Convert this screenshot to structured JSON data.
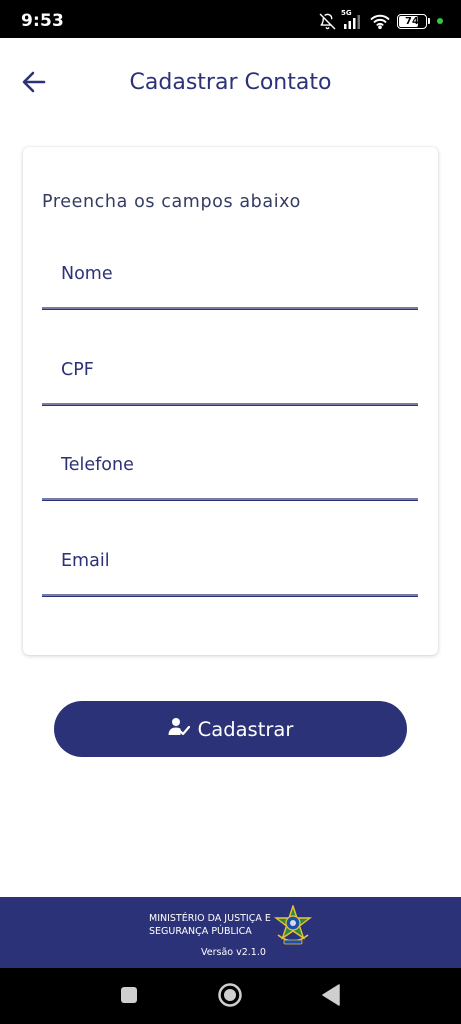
{
  "status_bar": {
    "time": "9:53",
    "network_label": "5G",
    "battery_level": "74",
    "battery_fraction": 0.74,
    "icons": [
      "bell-off-icon",
      "signal-icon",
      "wifi-icon",
      "battery-icon",
      "green-dot-indicator"
    ]
  },
  "header": {
    "back_icon": "arrow-left-icon",
    "title": "Cadastrar Contato"
  },
  "form": {
    "heading": "Preencha os campos abaixo",
    "fields": [
      {
        "label": "Nome",
        "value": ""
      },
      {
        "label": "CPF",
        "value": ""
      },
      {
        "label": "Telefone",
        "value": ""
      },
      {
        "label": "Email",
        "value": ""
      }
    ]
  },
  "submit": {
    "icon": "user-check-icon",
    "label": "Cadastrar"
  },
  "footer": {
    "ministry_line1": "MINISTÉRIO DA JUSTIÇA E",
    "ministry_line2": "SEGURANÇA PÚBLICA",
    "version": "Versão v2.1.0",
    "emblem": "coat-of-arms-icon"
  },
  "nav_bar": {
    "buttons": [
      "recents-square-icon",
      "home-circle-icon",
      "back-triangle-icon"
    ]
  },
  "colors": {
    "primary": "#2c3277",
    "background": "#ffffff",
    "underline": "#7a7ba6",
    "status_bar": "#000000",
    "indicator_green": "#2ecc40"
  }
}
